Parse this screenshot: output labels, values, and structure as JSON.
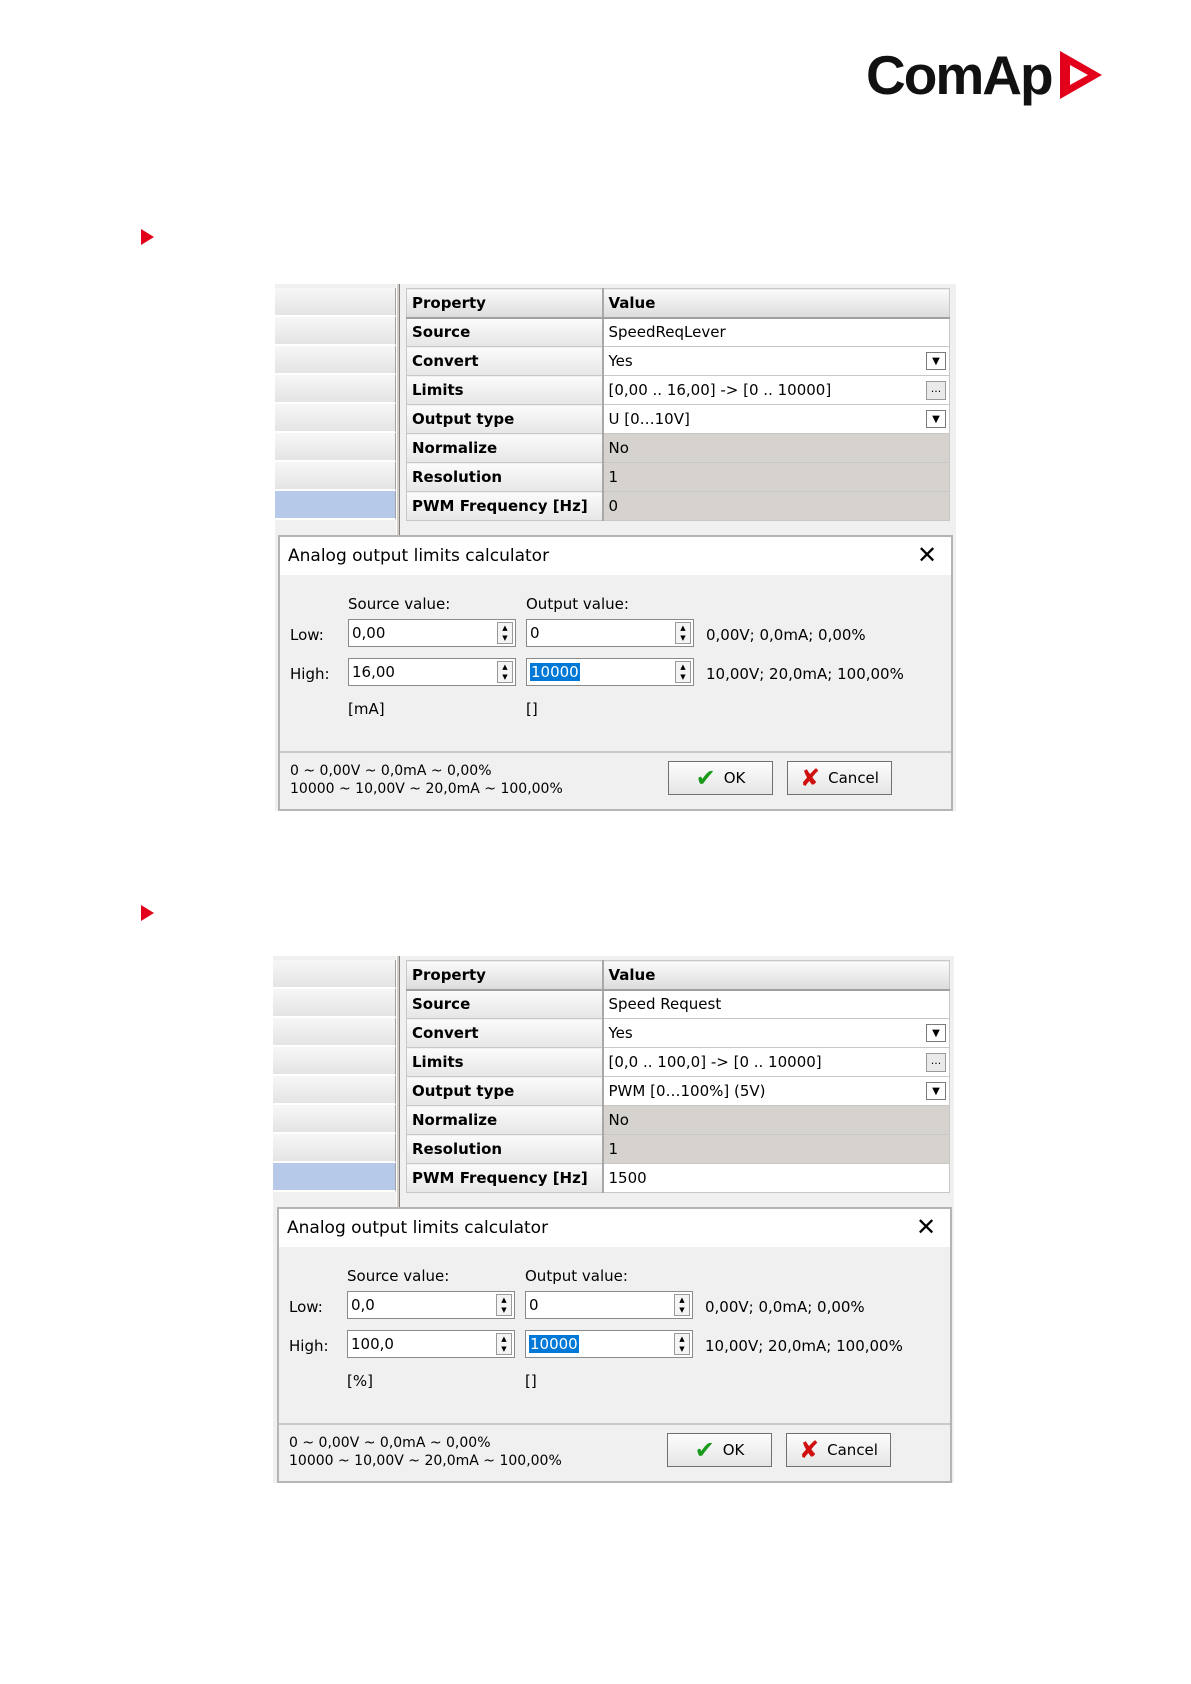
{
  "logo": {
    "text": "ComAp"
  },
  "colors": {
    "brand_red": "#e2001a",
    "selection": "#0078d7",
    "readonly_cell": "#d6d3ce"
  },
  "screens": [
    {
      "grid": {
        "header": {
          "property": "Property",
          "value": "Value"
        },
        "rows": [
          {
            "property": "Source",
            "value": "SpeedReqLever",
            "control": "none",
            "readonly": false
          },
          {
            "property": "Convert",
            "value": "Yes",
            "control": "dropdown",
            "readonly": false
          },
          {
            "property": "Limits",
            "value": "[0,00 .. 16,00] -> [0 .. 10000]",
            "control": "ellipsis",
            "readonly": false
          },
          {
            "property": "Output type",
            "value": "U [0…10V]",
            "control": "dropdown",
            "readonly": false
          },
          {
            "property": "Normalize",
            "value": "No",
            "control": "none",
            "readonly": true
          },
          {
            "property": "Resolution",
            "value": "1",
            "control": "none",
            "readonly": true
          },
          {
            "property": "PWM Frequency [Hz]",
            "value": "0",
            "control": "none",
            "readonly": true
          }
        ]
      },
      "dialog": {
        "title": "Analog output limits calculator",
        "source_label": "Source value:",
        "output_label": "Output value:",
        "low_label": "Low:",
        "high_label": "High:",
        "low_source": "0,00",
        "low_output": "0",
        "high_source": "16,00",
        "high_output": "10000",
        "low_result": "0,00V; 0,0mA; 0,00%",
        "high_result": "10,00V; 20,0mA; 100,00%",
        "source_unit": "[mA]",
        "output_unit": "[]",
        "summary_1": "0 ~ 0,00V ~ 0,0mA ~ 0,00%",
        "summary_2": "10000 ~ 10,00V ~ 20,0mA ~ 100,00%",
        "ok_label": "OK",
        "cancel_label": "Cancel"
      }
    },
    {
      "grid": {
        "header": {
          "property": "Property",
          "value": "Value"
        },
        "rows": [
          {
            "property": "Source",
            "value": "Speed Request",
            "control": "none",
            "readonly": false
          },
          {
            "property": "Convert",
            "value": "Yes",
            "control": "dropdown",
            "readonly": false
          },
          {
            "property": "Limits",
            "value": "[0,0 .. 100,0] -> [0 .. 10000]",
            "control": "ellipsis",
            "readonly": false
          },
          {
            "property": "Output type",
            "value": "PWM [0…100%] (5V)",
            "control": "dropdown",
            "readonly": false
          },
          {
            "property": "Normalize",
            "value": "No",
            "control": "none",
            "readonly": true
          },
          {
            "property": "Resolution",
            "value": "1",
            "control": "none",
            "readonly": true
          },
          {
            "property": "PWM Frequency [Hz]",
            "value": "1500",
            "control": "none",
            "readonly": false
          }
        ]
      },
      "dialog": {
        "title": "Analog output limits calculator",
        "source_label": "Source value:",
        "output_label": "Output value:",
        "low_label": "Low:",
        "high_label": "High:",
        "low_source": "0,0",
        "low_output": "0",
        "high_source": "100,0",
        "high_output": "10000",
        "low_result": "0,00V; 0,0mA; 0,00%",
        "high_result": "10,00V; 20,0mA; 100,00%",
        "source_unit": "[%]",
        "output_unit": "[]",
        "summary_1": "0 ~ 0,00V ~ 0,0mA ~ 0,00%",
        "summary_2": "10000 ~ 10,00V ~ 20,0mA ~ 100,00%",
        "ok_label": "OK",
        "cancel_label": "Cancel"
      }
    }
  ]
}
